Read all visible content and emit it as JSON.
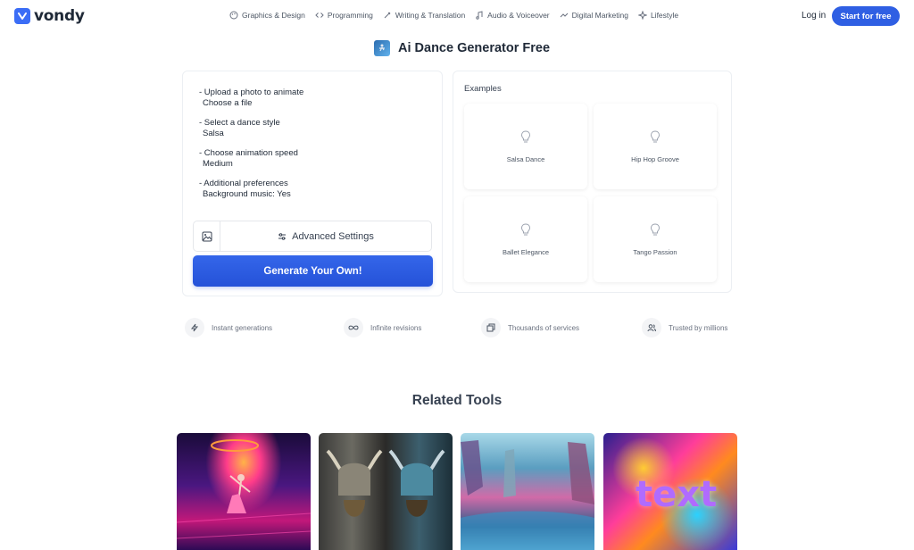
{
  "header": {
    "logo_text": "vondy",
    "nav": [
      {
        "label": "Graphics & Design",
        "icon": "palette-icon"
      },
      {
        "label": "Programming",
        "icon": "code-icon"
      },
      {
        "label": "Writing & Translation",
        "icon": "pen-icon"
      },
      {
        "label": "Audio & Voiceover",
        "icon": "music-icon"
      },
      {
        "label": "Digital Marketing",
        "icon": "trend-icon"
      },
      {
        "label": "Lifestyle",
        "icon": "sparkle-icon"
      }
    ],
    "login_label": "Log in",
    "start_label": "Start for free"
  },
  "page": {
    "title": "Ai Dance Generator Free"
  },
  "form": {
    "groups": [
      {
        "label": "- Upload a photo to animate",
        "value": "Choose a file"
      },
      {
        "label": "- Select a dance style",
        "value": "Salsa"
      },
      {
        "label": "- Choose animation speed",
        "value": "Medium"
      },
      {
        "label": "- Additional preferences",
        "value": "Background music: Yes"
      }
    ],
    "advanced_label": "Advanced Settings",
    "generate_label": "Generate Your Own!"
  },
  "examples": {
    "title": "Examples",
    "items": [
      "Salsa Dance",
      "Hip Hop Groove",
      "Ballet Elegance",
      "Tango Passion"
    ]
  },
  "features": [
    "Instant generations",
    "Infinite revisions",
    "Thousands of services",
    "Trusted by millions"
  ],
  "related": {
    "title": "Related Tools",
    "card4_text": "text"
  },
  "colors": {
    "accent": "#2f5fe3",
    "text": "#1f2937"
  }
}
